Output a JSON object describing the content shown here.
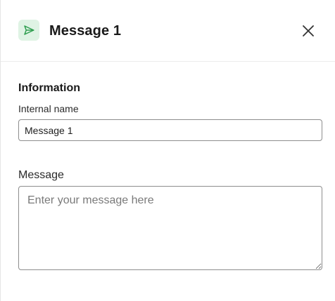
{
  "header": {
    "title": "Message 1",
    "icon": "send-icon",
    "icon_color": "#2e9e4f",
    "icon_bg": "#dff3e4",
    "close_icon": "close-icon"
  },
  "information": {
    "section_title": "Information",
    "internal_name_label": "Internal name",
    "internal_name_value": "Message 1"
  },
  "message": {
    "label": "Message",
    "placeholder": "Enter your message here"
  }
}
